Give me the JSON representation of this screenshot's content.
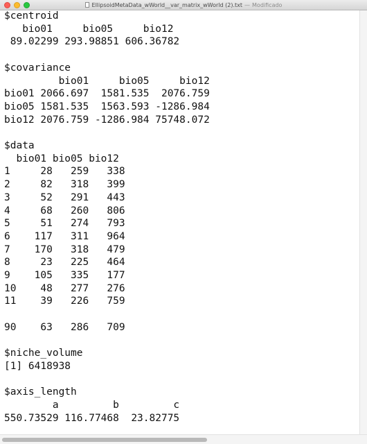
{
  "window": {
    "title": "EllipsoidMetaData_wWorld__var_matrix_wWorld (2).txt",
    "separator": "—",
    "status": "Modificado"
  },
  "document": {
    "lines": [
      "$centroid",
      "   bio01     bio05     bio12",
      " 89.02299 293.98851 606.36782",
      "",
      "$covariance",
      "         bio01     bio05     bio12",
      "bio01 2066.697  1581.535  2076.759",
      "bio05 1581.535  1563.593 -1286.984",
      "bio12 2076.759 -1286.984 75748.072",
      "",
      "$data",
      "  bio01 bio05 bio12",
      "1     28   259   338",
      "2     82   318   399",
      "3     52   291   443",
      "4     68   260   806",
      "5     51   274   793",
      "6    117   311   964",
      "7    170   318   479",
      "8     23   225   464",
      "9    105   335   177",
      "10    48   277   276",
      "11    39   226   759",
      "",
      "90    63   286   709",
      "",
      "$niche_volume",
      "[1] 6418938",
      "",
      "$axis_length",
      "        a         b         c",
      "550.73529 116.77468  23.82775"
    ]
  }
}
